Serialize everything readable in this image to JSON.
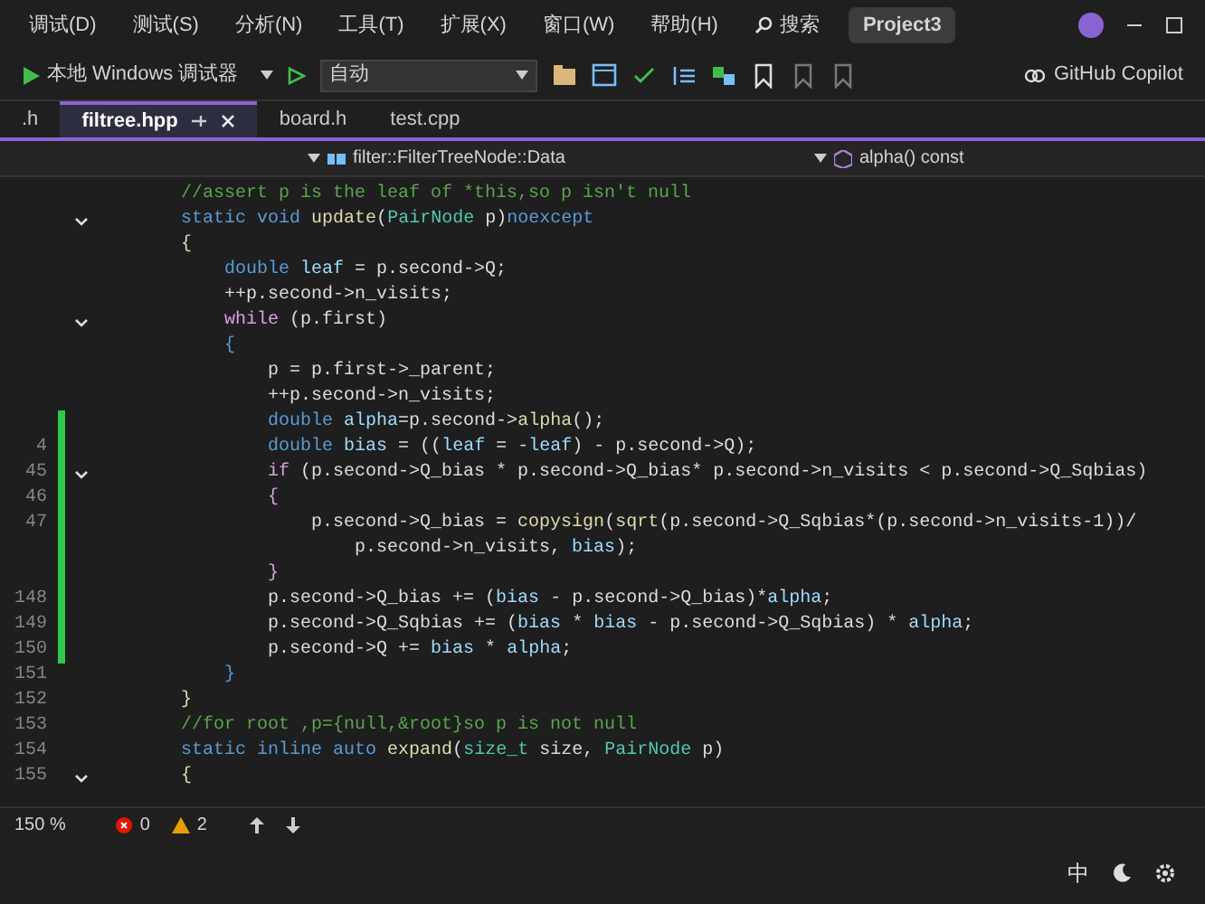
{
  "menu": [
    "调试(D)",
    "测试(S)",
    "分析(N)",
    "工具(T)",
    "扩展(X)",
    "窗口(W)",
    "帮助(H)"
  ],
  "search": {
    "label": "搜索"
  },
  "project": "Project3",
  "toolbar": {
    "debugger": "本地 Windows 调试器",
    "config": "自动",
    "copilot": "GitHub Copilot"
  },
  "tabs": [
    {
      "label": ".h",
      "selected": false
    },
    {
      "label": "filtree.hpp",
      "selected": true
    },
    {
      "label": "board.h",
      "selected": false
    },
    {
      "label": "test.cpp",
      "selected": false
    }
  ],
  "nav": {
    "scope": "filter::FilterTreeNode::Data",
    "member": "alpha() const"
  },
  "lines": [
    {
      "tokens": [
        {
          "kind": "comment",
          "text": "        //assert p is the leaf of *this,so p isn't null"
        }
      ]
    },
    {
      "foldable": true,
      "tokens": [
        {
          "kind": "kw",
          "text": "        static void "
        },
        {
          "kind": "fn",
          "text": "update"
        },
        {
          "kind": "plain",
          "text": "("
        },
        {
          "kind": "type",
          "text": "PairNode"
        },
        {
          "kind": "plain",
          "text": " p)"
        },
        {
          "kind": "kw",
          "text": "noexcept"
        }
      ]
    },
    {
      "tokens": [
        {
          "kind": "fn",
          "text": "        {"
        }
      ]
    },
    {
      "tokens": [
        {
          "kind": "kw",
          "text": "            double "
        },
        {
          "kind": "var",
          "text": "leaf"
        },
        {
          "kind": "plain",
          "text": " = p.second->Q;"
        }
      ]
    },
    {
      "tokens": [
        {
          "kind": "plain",
          "text": "            ++p.second->n_visits;"
        }
      ]
    },
    {
      "foldable": true,
      "tokens": [
        {
          "kind": "ctrl",
          "text": "            while"
        },
        {
          "kind": "plain",
          "text": " (p.first)"
        }
      ]
    },
    {
      "tokens": [
        {
          "kind": "kw",
          "text": "            {"
        }
      ]
    },
    {
      "tokens": [
        {
          "kind": "plain",
          "text": "                p = p.first->_parent;"
        }
      ]
    },
    {
      "tokens": [
        {
          "kind": "plain",
          "text": "                ++p.second->n_visits;"
        }
      ]
    },
    {
      "changed": true,
      "tokens": [
        {
          "kind": "kw",
          "text": "                double "
        },
        {
          "kind": "var",
          "text": "alpha"
        },
        {
          "kind": "plain",
          "text": "=p.second->"
        },
        {
          "kind": "fn",
          "text": "alpha"
        },
        {
          "kind": "plain",
          "text": "();"
        }
      ]
    },
    {
      "changed": true,
      "number": "4",
      "tokens": [
        {
          "kind": "kw",
          "text": "                double "
        },
        {
          "kind": "var",
          "text": "bias"
        },
        {
          "kind": "plain",
          "text": " = (("
        },
        {
          "kind": "var",
          "text": "leaf"
        },
        {
          "kind": "plain",
          "text": " = -"
        },
        {
          "kind": "var",
          "text": "leaf"
        },
        {
          "kind": "plain",
          "text": ") - p.second->Q);"
        }
      ]
    },
    {
      "changed": true,
      "foldable": true,
      "number": "45",
      "tokens": [
        {
          "kind": "ctrl",
          "text": "                if"
        },
        {
          "kind": "plain",
          "text": " (p.second->Q_bias * p.second->Q_bias* p.second->n_visits < p.second->Q_Sqbias)"
        }
      ]
    },
    {
      "changed": true,
      "number": "46",
      "tokens": [
        {
          "kind": "ctrl",
          "text": "                {"
        }
      ]
    },
    {
      "changed": true,
      "number": "47",
      "tokens": [
        {
          "kind": "plain",
          "text": "                    p.second->Q_bias = "
        },
        {
          "kind": "fn",
          "text": "copysign"
        },
        {
          "kind": "plain",
          "text": "("
        },
        {
          "kind": "fn",
          "text": "sqrt"
        },
        {
          "kind": "plain",
          "text": "(p.second->Q_Sqbias*(p.second->n_visits-1))/"
        }
      ]
    },
    {
      "changed": true,
      "tokens": [
        {
          "kind": "plain",
          "text": "                        p.second->n_visits, "
        },
        {
          "kind": "var",
          "text": "bias"
        },
        {
          "kind": "plain",
          "text": ");"
        }
      ]
    },
    {
      "changed": true,
      "tokens": [
        {
          "kind": "ctrl",
          "text": "                }"
        }
      ]
    },
    {
      "changed": true,
      "number": "148",
      "tokens": [
        {
          "kind": "plain",
          "text": "                p.second->Q_bias += ("
        },
        {
          "kind": "var",
          "text": "bias"
        },
        {
          "kind": "plain",
          "text": " - p.second->Q_bias)*"
        },
        {
          "kind": "var",
          "text": "alpha"
        },
        {
          "kind": "plain",
          "text": ";"
        }
      ]
    },
    {
      "changed": true,
      "number": "149",
      "tokens": [
        {
          "kind": "plain",
          "text": "                p.second->Q_Sqbias += ("
        },
        {
          "kind": "var",
          "text": "bias"
        },
        {
          "kind": "plain",
          "text": " * "
        },
        {
          "kind": "var",
          "text": "bias"
        },
        {
          "kind": "plain",
          "text": " - p.second->Q_Sqbias) * "
        },
        {
          "kind": "var",
          "text": "alpha"
        },
        {
          "kind": "plain",
          "text": ";"
        }
      ]
    },
    {
      "changed": true,
      "number": "150",
      "tokens": [
        {
          "kind": "plain",
          "text": "                p.second->Q += "
        },
        {
          "kind": "var",
          "text": "bias"
        },
        {
          "kind": "plain",
          "text": " * "
        },
        {
          "kind": "var",
          "text": "alpha"
        },
        {
          "kind": "plain",
          "text": ";"
        }
      ]
    },
    {
      "number": "151",
      "tokens": [
        {
          "kind": "kw",
          "text": "            }"
        }
      ]
    },
    {
      "number": "152",
      "tokens": [
        {
          "kind": "fn",
          "text": "        }"
        }
      ]
    },
    {
      "number": "153",
      "tokens": [
        {
          "kind": "comment",
          "text": "        //for root ,p={null,&root}so p is not null"
        }
      ]
    },
    {
      "number": "154",
      "tokens": [
        {
          "kind": "kw",
          "text": "        static inline auto "
        },
        {
          "kind": "fn",
          "text": "expand"
        },
        {
          "kind": "plain",
          "text": "("
        },
        {
          "kind": "type",
          "text": "size_t"
        },
        {
          "kind": "plain",
          "text": " size, "
        },
        {
          "kind": "type",
          "text": "PairNode"
        },
        {
          "kind": "plain",
          "text": " p)"
        }
      ]
    },
    {
      "number": "155",
      "foldable": true,
      "tokens": [
        {
          "kind": "fn",
          "text": "        {"
        }
      ]
    }
  ],
  "status": {
    "zoom": "150 %",
    "errors": "0",
    "warnings": "2"
  },
  "taskbar": {
    "ime": "中"
  }
}
